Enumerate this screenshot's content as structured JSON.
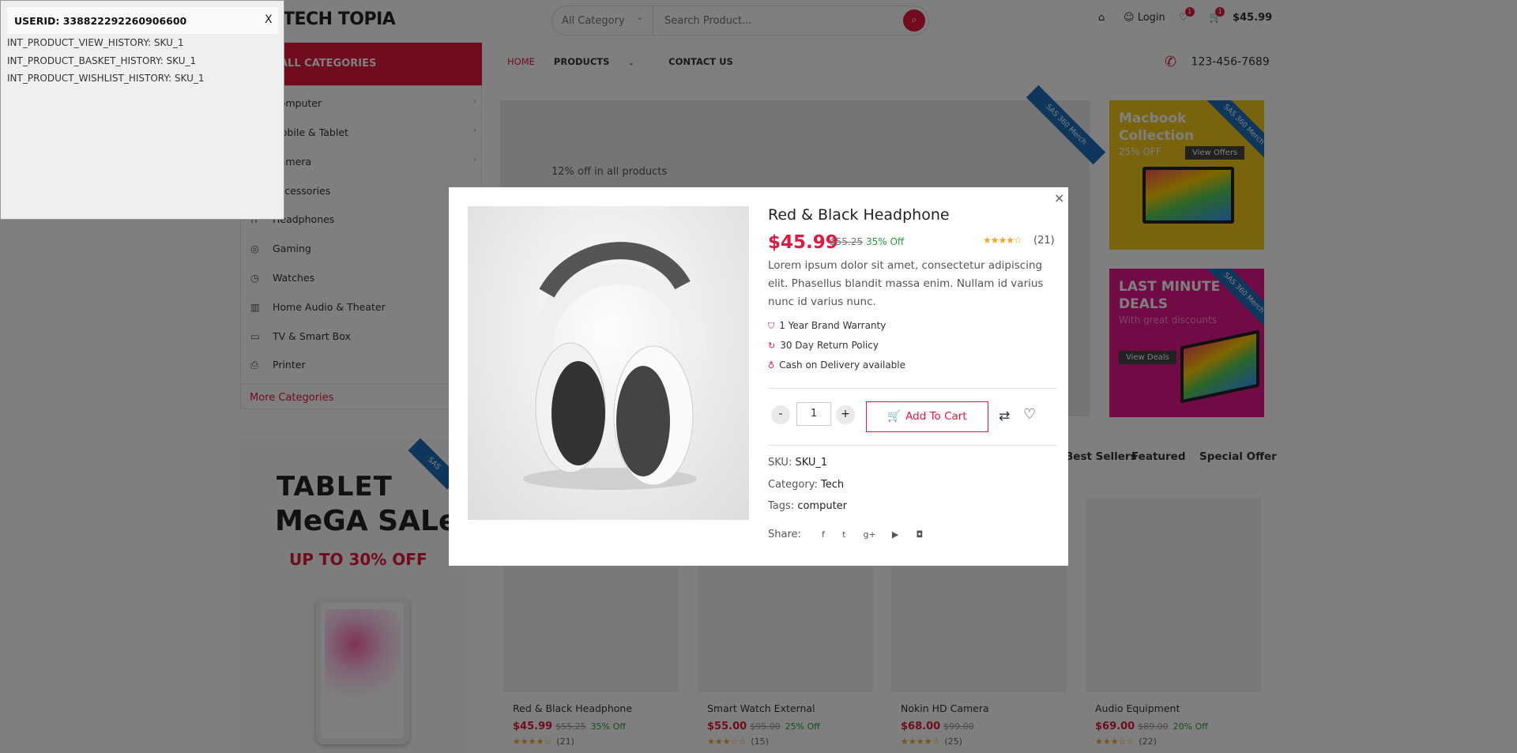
{
  "header": {
    "logo": "TECH TOPIA",
    "category_select": "All Category",
    "search_placeholder": "Search Product...",
    "login": "Login",
    "wishlist_count": "1",
    "cart_count": "1",
    "cart_total": "$45.99"
  },
  "nav": {
    "categories_label": "ALL CATEGORIES",
    "menu": [
      "HOME",
      "PRODUCTS",
      "CONTACT US"
    ],
    "phone": "123-456-7689"
  },
  "sidebar": {
    "items": [
      {
        "label": "Computer",
        "icon": "computer-icon"
      },
      {
        "label": "Mobile & Tablet",
        "icon": "mobile-icon"
      },
      {
        "label": "Camera",
        "icon": "camera-icon"
      },
      {
        "label": "Accessories",
        "icon": "accessories-icon"
      },
      {
        "label": "Headphones",
        "icon": "headphones-icon"
      },
      {
        "label": "Gaming",
        "icon": "gamepad-icon"
      },
      {
        "label": "Watches",
        "icon": "watch-icon"
      },
      {
        "label": "Home Audio & Theater",
        "icon": "speaker-icon"
      },
      {
        "label": "TV & Smart Box",
        "icon": "tv-icon"
      },
      {
        "label": "Printer",
        "icon": "printer-icon"
      }
    ],
    "more": "More Categories"
  },
  "hero": {
    "text": "12% off in all products",
    "ribbon": "SAS 360 Merch"
  },
  "banners": {
    "mac": {
      "title1": "Macbook",
      "title2": "Collection",
      "sub": "25% OFF",
      "button": "View Offers",
      "ribbon": "SAS 360 Merch"
    },
    "deals": {
      "title1": "LAST MINUTE",
      "title2": "DEALS",
      "sub": "With great discounts",
      "button": "View Deals",
      "ribbon": "SAS 360 Merch"
    }
  },
  "tablet_promo": {
    "line1": "TABLET",
    "line2": "MeGA SALe",
    "line3": "UP TO 30% OFF",
    "ribbon": "SAS"
  },
  "tabs": [
    "Best Sellers",
    "Featured",
    "Special Offer"
  ],
  "products": [
    {
      "name": "Red & Black Headphone",
      "price": "$45.99",
      "old": "$55.25",
      "off": "35% Off",
      "reviews": "(21)"
    },
    {
      "name": "Smart Watch External",
      "price": "$55.00",
      "old": "$95.00",
      "off": "25% Off",
      "reviews": "(15)"
    },
    {
      "name": "Nokin HD Camera",
      "price": "$68.00",
      "old": "$99.00",
      "off": "",
      "reviews": "(25)"
    },
    {
      "name": "Audio Equipment",
      "price": "$69.00",
      "old": "$89.00",
      "off": "20% Off",
      "reviews": "(22)"
    }
  ],
  "modal": {
    "close": "×",
    "title": "Red & Black Headphone",
    "price": "$45.99",
    "old_price": "$55.25",
    "discount": "35% Off",
    "rating": 4,
    "reviews": "(21)",
    "description": "Lorem ipsum dolor sit amet, consectetur adipiscing elit. Phasellus blandit massa enim. Nullam id varius nunc id varius nunc.",
    "features": [
      "1 Year Brand Warranty",
      "30 Day Return Policy",
      "Cash on Delivery available"
    ],
    "qty": "1",
    "minus": "-",
    "plus": "+",
    "add_to_cart": "Add To Cart",
    "sku_label": "SKU:",
    "sku": "SKU_1",
    "category_label": "Category:",
    "category": "Tech",
    "tags_label": "Tags:",
    "tags": "computer",
    "share_label": "Share:"
  },
  "debug": {
    "userid": "USERID: 338822292260906600",
    "close": "X",
    "lines": [
      "INT_PRODUCT_VIEW_HISTORY: SKU_1",
      "INT_PRODUCT_BASKET_HISTORY: SKU_1",
      "INT_PRODUCT_WISHLIST_HISTORY: SKU_1"
    ]
  },
  "colors": {
    "accent": "#e2183e",
    "success": "#2a9d3c",
    "star": "#f4a623"
  }
}
